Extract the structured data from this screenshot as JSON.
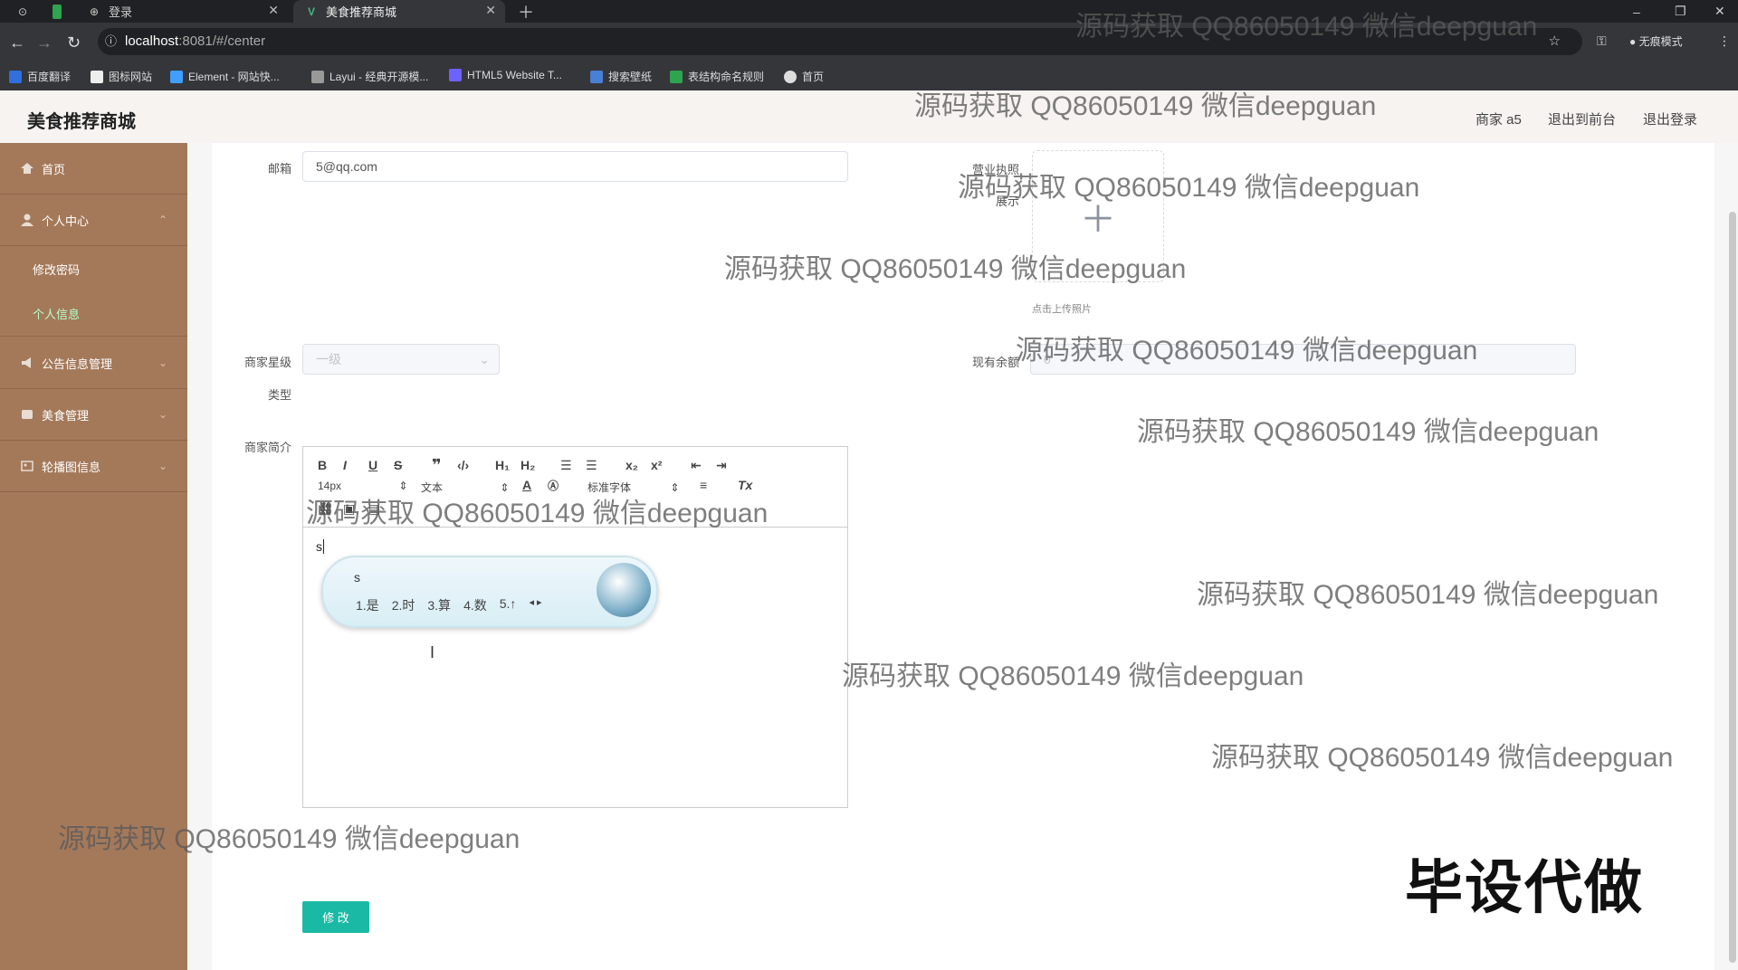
{
  "browser": {
    "tabs": [
      {
        "label": "登录"
      },
      {
        "label": "美食推荐商城"
      }
    ],
    "url_host": "localhost",
    "url_path": ":8081/#/center",
    "incognito_label": "无痕模式",
    "bookmarks": [
      {
        "label": "百度翻译"
      },
      {
        "label": "图标网站"
      },
      {
        "label": "Element - 网站快..."
      },
      {
        "label": "Layui - 经典开源模..."
      },
      {
        "label": "HTML5 Website T..."
      },
      {
        "label": "搜索壁纸"
      },
      {
        "label": "表结构命名规则"
      },
      {
        "label": "首页"
      }
    ]
  },
  "header": {
    "title": "美食推荐商城",
    "user": "商家 a5",
    "back_to_front": "退出到前台",
    "logout": "退出登录"
  },
  "sidebar": {
    "items": [
      {
        "label": "首页"
      },
      {
        "label": "个人中心"
      },
      {
        "label": "修改密码"
      },
      {
        "label": "个人信息"
      },
      {
        "label": "公告信息管理"
      },
      {
        "label": "美食管理"
      },
      {
        "label": "轮播图信息"
      }
    ]
  },
  "form": {
    "email_label": "邮箱",
    "email_value": "5@qq.com",
    "license_label_1": "营业执照",
    "license_label_2": "展示",
    "upload_tip": "点击上传照片",
    "level_label": "商家星级",
    "level_value": "一级",
    "type_label": "类型",
    "balance_label": "现有余额",
    "balance_value": "0",
    "intro_label": "商家简介",
    "submit_label": "修 改"
  },
  "editor": {
    "font_size": "14px",
    "heading": "文本",
    "font_family": "标准字体",
    "content": "s"
  },
  "ime": {
    "input": "s",
    "candidates": [
      "1.是",
      "2.时",
      "3.算",
      "4.数",
      "5.↑"
    ]
  },
  "watermark": "源码获取 QQ86050149 微信deepguan",
  "overlay_text": "毕设代做",
  "colors": {
    "sidebar_bg": "#a4795a",
    "active_menu": "#b7ffca",
    "primary_button": "#19b9a5"
  }
}
